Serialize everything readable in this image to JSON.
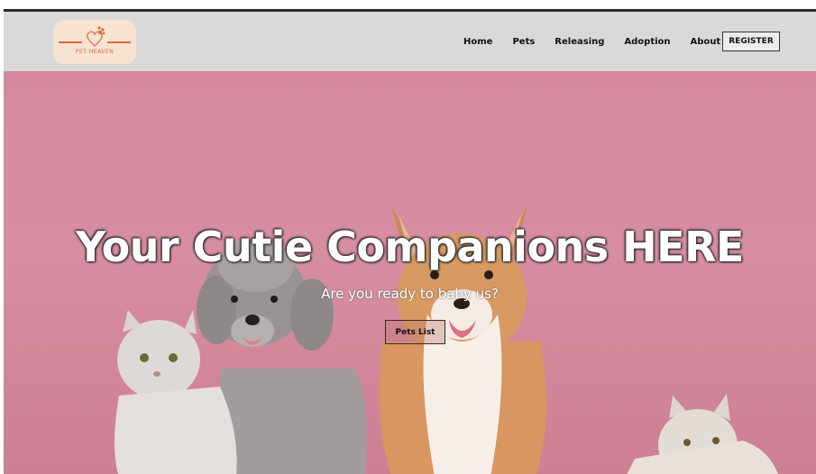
{
  "brand": {
    "name": "PET HEAVEN",
    "color": "#d96a44",
    "badge_bg": "#f7e3cf"
  },
  "nav": {
    "items": [
      {
        "label": "Home"
      },
      {
        "label": "Pets"
      },
      {
        "label": "Releasing"
      },
      {
        "label": "Adoption"
      },
      {
        "label": "About Us"
      }
    ],
    "register_label": "REGISTER"
  },
  "hero": {
    "headline": "Your Cutie Companions HERE",
    "subheadline": "Are you ready to baby us?",
    "button_label": "Pets List",
    "background_color": "#d78ea0"
  }
}
